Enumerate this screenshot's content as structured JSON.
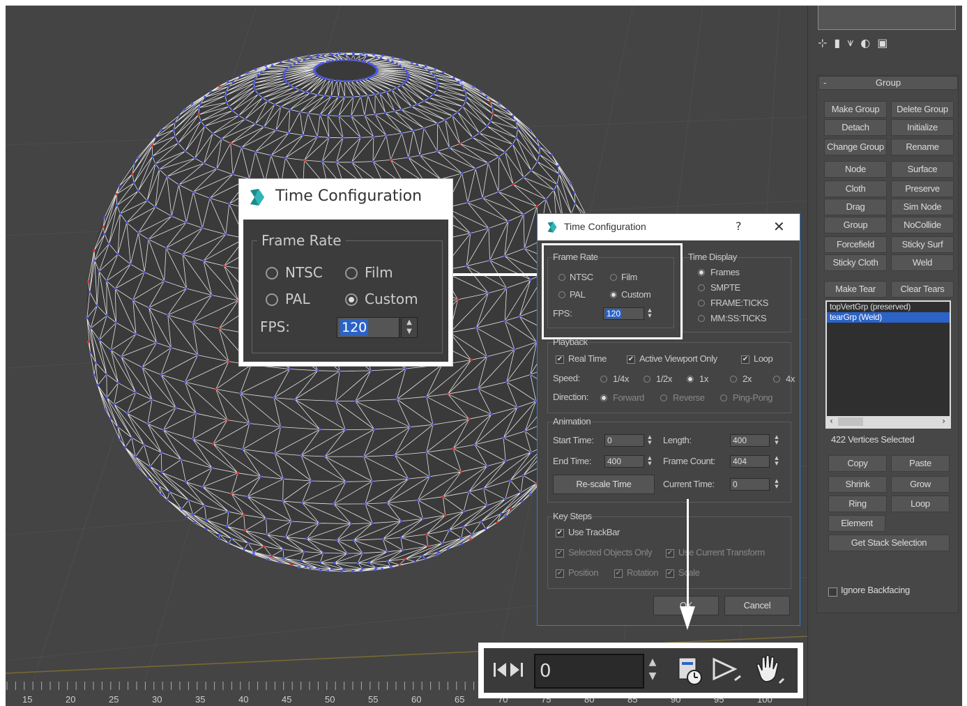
{
  "timeline": {
    "ticks": [
      "15",
      "20",
      "25",
      "30",
      "35",
      "40",
      "45",
      "50",
      "55",
      "60",
      "65",
      "70",
      "75",
      "80",
      "85",
      "90",
      "95",
      "100"
    ]
  },
  "zoom_dialog": {
    "title": "Time Configuration",
    "group_label": "Frame Rate",
    "ntsc": "NTSC",
    "film": "Film",
    "pal": "PAL",
    "custom": "Custom",
    "fps_label": "FPS:",
    "fps_value": "120",
    "selected": "Custom"
  },
  "dialog": {
    "title": "Time Configuration",
    "help": "?",
    "close": "✕",
    "frame_rate": {
      "label": "Frame Rate",
      "ntsc": "NTSC",
      "film": "Film",
      "pal": "PAL",
      "custom": "Custom",
      "fps_label": "FPS:",
      "fps_value": "120"
    },
    "time_display": {
      "label": "Time Display",
      "options": [
        "Frames",
        "SMPTE",
        "FRAME:TICKS",
        "MM:SS:TICKS"
      ],
      "selected": "Frames"
    },
    "playback": {
      "label": "Playback",
      "real_time": "Real Time",
      "active_viewport": "Active Viewport Only",
      "loop": "Loop",
      "speed_label": "Speed:",
      "speeds": [
        "1/4x",
        "1/2x",
        "1x",
        "2x",
        "4x"
      ],
      "speed_selected": "1x",
      "direction_label": "Direction:",
      "directions": [
        "Forward",
        "Reverse",
        "Ping-Pong"
      ]
    },
    "animation": {
      "label": "Animation",
      "start_time_label": "Start Time:",
      "start_time": "0",
      "length_label": "Length:",
      "length": "400",
      "end_time_label": "End Time:",
      "end_time": "400",
      "frame_count_label": "Frame Count:",
      "frame_count": "404",
      "rescale": "Re-scale Time",
      "current_time_label": "Current Time:",
      "current_time": "0"
    },
    "key_steps": {
      "label": "Key Steps",
      "use_trackbar": "Use TrackBar",
      "selected_only": "Selected Objects Only",
      "use_current": "Use Current Transform",
      "position": "Position",
      "rotation": "Rotation",
      "scale": "Scale"
    },
    "ok": "OK",
    "cancel": "Cancel"
  },
  "toolbar": {
    "frame_value": "0"
  },
  "right_panel": {
    "group_header": "Group",
    "buttons": [
      "Make Group",
      "Delete Group",
      "Detach",
      "Initialize",
      "Change Group",
      "Rename",
      "Node",
      "Surface",
      "Cloth",
      "Preserve",
      "Drag",
      "Sim Node",
      "Group",
      "NoCollide",
      "Forcefield",
      "Sticky Surf",
      "Sticky Cloth",
      "Weld"
    ],
    "make_tear": "Make Tear",
    "clear_tears": "Clear Tears",
    "list": [
      "topVertGrp (preserved)",
      "tearGrp (Weld)"
    ],
    "vertices_selected": "422 Vertices Selected",
    "sel_buttons": [
      "Copy",
      "Paste",
      "Shrink",
      "Grow",
      "Ring",
      "Loop"
    ],
    "element": "Element",
    "get_stack": "Get Stack Selection",
    "ignore_backfacing": "Ignore Backfacing"
  },
  "colors": {
    "accent": "#2b63c6",
    "vertex_blue": "#4b57e6",
    "vertex_red": "#e03030",
    "dialog_border": "#2e7dd6"
  }
}
